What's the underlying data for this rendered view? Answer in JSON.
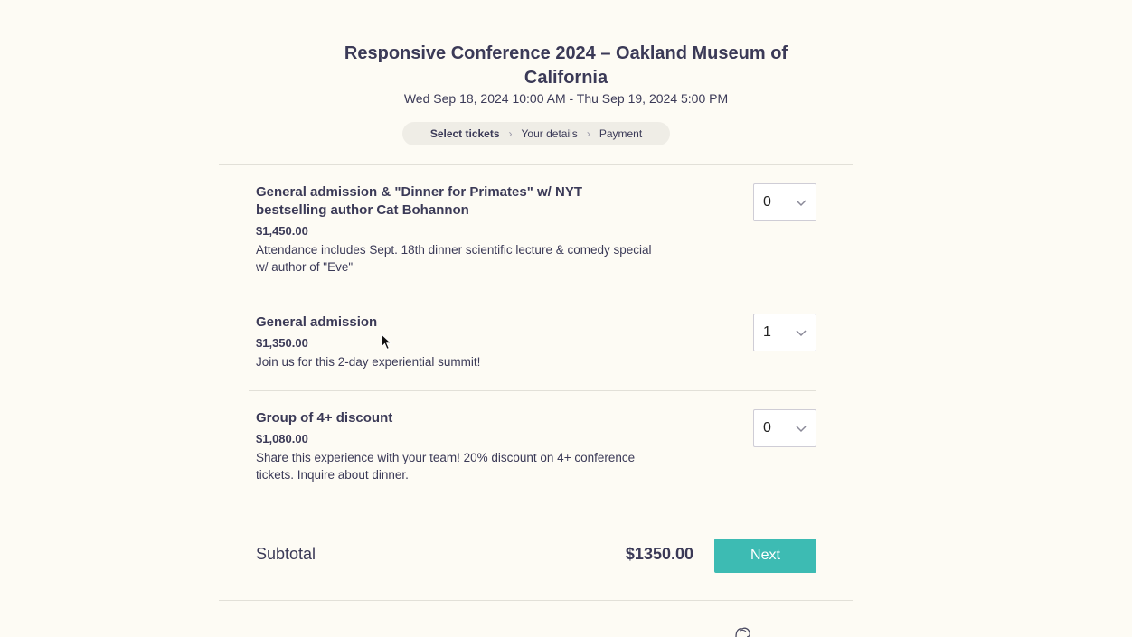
{
  "event": {
    "title": "Responsive Conference 2024 – Oakland Museum of California",
    "date": "Wed Sep 18, 2024 10:00 AM - Thu Sep 19, 2024 5:00 PM"
  },
  "steps": [
    {
      "label": "Select tickets",
      "active": true
    },
    {
      "label": "Your details",
      "active": false
    },
    {
      "label": "Payment",
      "active": false
    }
  ],
  "tickets": [
    {
      "name": "General admission & \"Dinner for Primates\" w/ NYT bestselling author Cat Bohannon",
      "price": "$1,450.00",
      "description": "Attendance includes Sept. 18th dinner scientific lecture & comedy special w/ author of \"Eve\"",
      "quantity": "0"
    },
    {
      "name": "General admission",
      "price": "$1,350.00",
      "description": "Join us for this 2-day experiential summit!",
      "quantity": "1"
    },
    {
      "name": "Group of 4+ discount",
      "price": "$1,080.00",
      "description": "Share this experience with your team! 20% discount on 4+ conference tickets. Inquire about dinner.",
      "quantity": "0"
    }
  ],
  "summary": {
    "subtotal_label": "Subtotal",
    "subtotal_value": "$1350.00",
    "next_label": "Next"
  },
  "colors": {
    "background": "#fdfbf4",
    "text": "#3b3a57",
    "accent": "#3dbbb3"
  },
  "icons": {
    "step_separator": "chevron-right-icon",
    "select": "chevron-down-icon",
    "cursor": "mouse-pointer-icon"
  }
}
